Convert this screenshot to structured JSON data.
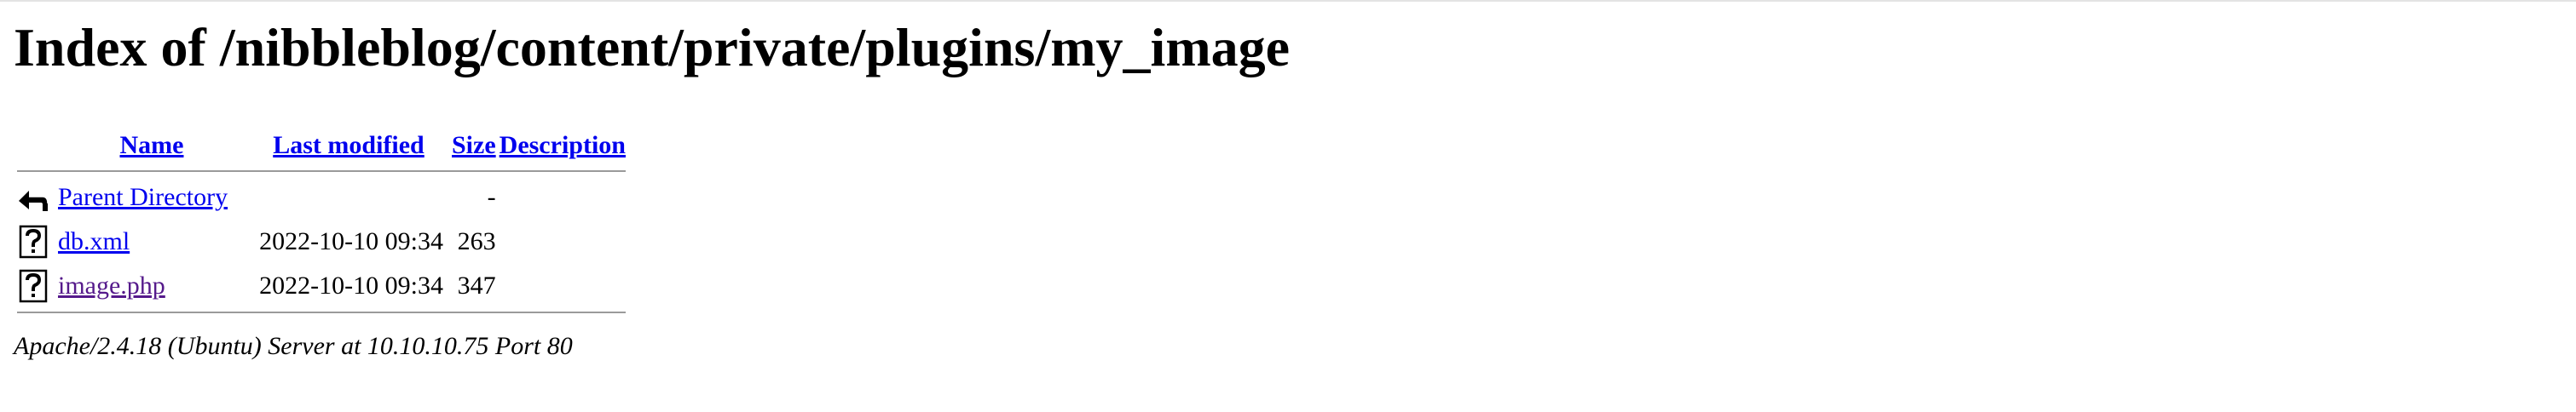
{
  "page": {
    "heading": "Index of /nibbleblog/content/private/plugins/my_image"
  },
  "listing": {
    "columns": {
      "name": "Name",
      "last_modified": "Last modified",
      "size": "Size",
      "description": "Description"
    },
    "rows": [
      {
        "icon": "back-icon",
        "name": "Parent Directory",
        "last_modified": "",
        "size": "-",
        "description": ""
      },
      {
        "icon": "unknown-file-icon",
        "name": "db.xml",
        "last_modified": "2022-10-10 09:34",
        "size": "263",
        "description": ""
      },
      {
        "icon": "unknown-file-icon",
        "name": "image.php",
        "last_modified": "2022-10-10 09:34",
        "size": "347",
        "description": ""
      }
    ]
  },
  "footer": {
    "server_signature": "Apache/2.4.18 (Ubuntu) Server at 10.10.10.75 Port 80"
  },
  "colors": {
    "link": "#0000ee",
    "visited_link": "#551a8b",
    "rule": "#9a9a9a"
  }
}
